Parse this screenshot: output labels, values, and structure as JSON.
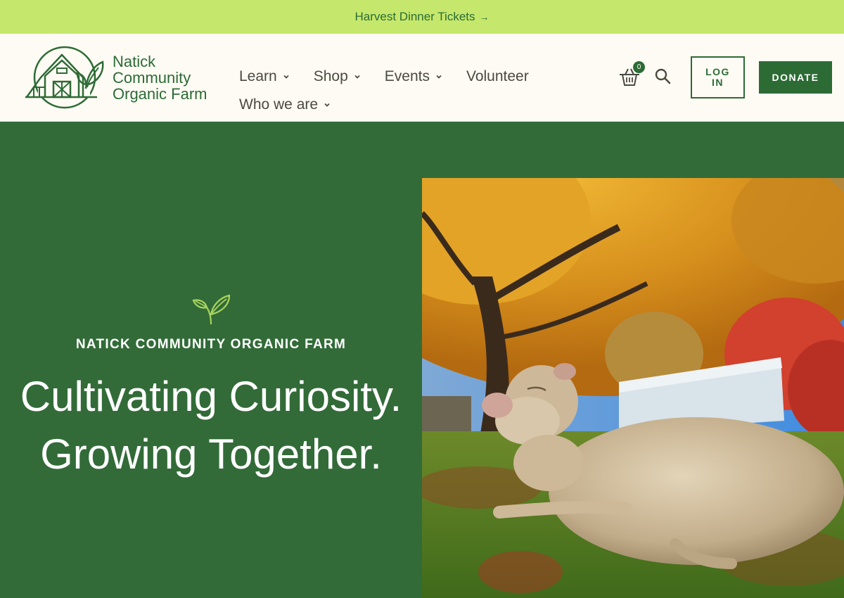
{
  "announcement": {
    "text": "Harvest Dinner Tickets",
    "arrow": "→"
  },
  "logo": {
    "line1": "Natick",
    "line2": "Community",
    "line3": "Organic Farm",
    "icon": "barn-leaf-logo"
  },
  "nav": {
    "learn": "Learn",
    "shop": "Shop",
    "events": "Events",
    "volunteer": "Volunteer",
    "who_we_are": "Who we are"
  },
  "cart": {
    "icon": "basket-icon",
    "count": "0"
  },
  "search": {
    "icon": "search-icon"
  },
  "buttons": {
    "login": "LOG IN",
    "donate": "DONATE"
  },
  "hero": {
    "icon": "sprout-icon",
    "eyebrow": "NATICK COMMUNITY ORGANIC FARM",
    "headline_line1": "Cultivating Curiosity.",
    "headline_line2": "Growing Together."
  },
  "colors": {
    "brand_green": "#326b38",
    "accent_lime": "#c5e86c",
    "background": "#fefbf4"
  }
}
